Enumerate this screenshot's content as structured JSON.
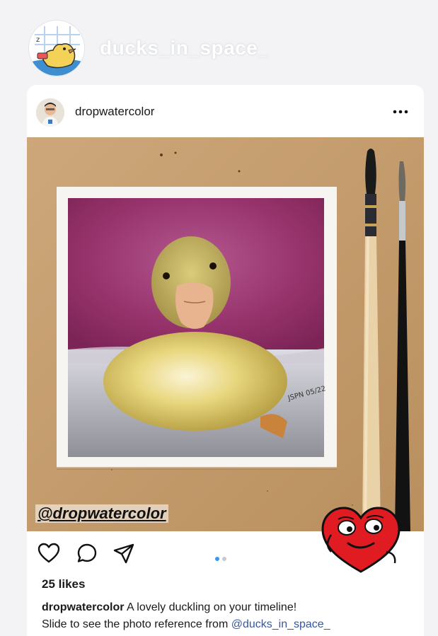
{
  "story": {
    "username": "ducks_in_space_"
  },
  "post": {
    "username": "dropwatercolor",
    "more_label": "More options",
    "photo_watermark": "@dropwatercolor",
    "signature": "JSPN 05/22",
    "carousel": {
      "total": 2,
      "current": 1
    },
    "likes": "25 likes",
    "caption": {
      "username": "dropwatercolor",
      "text": "A lovely duckling on your timeline!",
      "line2": "Slide to see the photo reference from",
      "mention": "@ducks_in_space_"
    }
  },
  "icons": {
    "like": "heart-icon",
    "comment": "comment-bubble-icon",
    "share": "paper-plane-icon",
    "more": "ellipsis-icon",
    "sticker": "heart-face-sticker"
  },
  "colors": {
    "accent": "#3897f0",
    "mention": "#385898",
    "sticker_red": "#e11b22"
  }
}
